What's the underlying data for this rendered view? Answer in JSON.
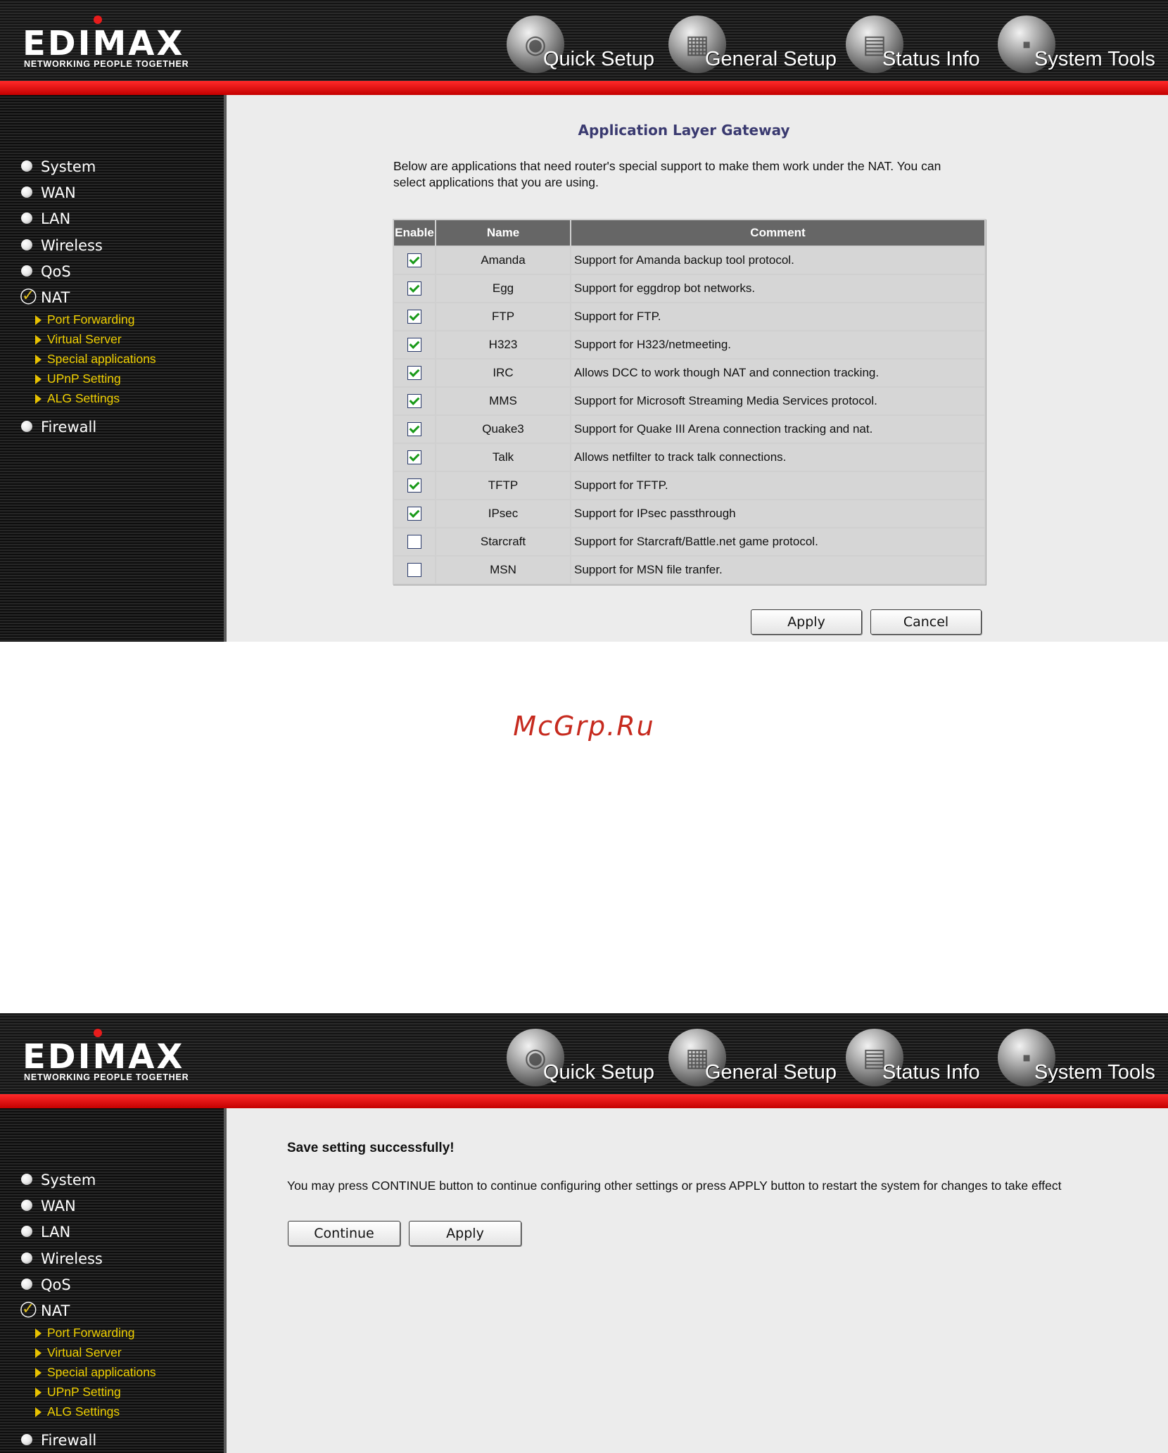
{
  "brand": {
    "logo_text": "EDIMAX",
    "tagline": "NETWORKING PEOPLE TOGETHER",
    "logo_dot_color": "#e81c1c"
  },
  "top_nav": [
    {
      "label": "Quick Setup",
      "icon": "quick-setup-orb-icon"
    },
    {
      "label": "General Setup",
      "icon": "general-setup-orb-icon"
    },
    {
      "label": "Status Info",
      "icon": "status-info-orb-icon"
    },
    {
      "label": "System Tools",
      "icon": "system-tools-orb-icon"
    }
  ],
  "sidebar": {
    "items": [
      "System",
      "WAN",
      "LAN",
      "Wireless",
      "QoS",
      "NAT",
      "Firewall"
    ],
    "active_item": "NAT",
    "subitems": [
      "Port Forwarding",
      "Virtual Server",
      "Special applications",
      "UPnP Setting",
      "ALG Settings"
    ]
  },
  "alg": {
    "title": "Application Layer Gateway",
    "description": "Below are applications that need router's special support to make them work under the NAT. You can select applications that you are using.",
    "headers": [
      "Enable",
      "Name",
      "Comment"
    ],
    "rows": [
      {
        "enabled": true,
        "name": "Amanda",
        "comment": "Support for Amanda backup tool protocol."
      },
      {
        "enabled": true,
        "name": "Egg",
        "comment": "Support for eggdrop bot networks."
      },
      {
        "enabled": true,
        "name": "FTP",
        "comment": "Support for FTP."
      },
      {
        "enabled": true,
        "name": "H323",
        "comment": "Support for H323/netmeeting."
      },
      {
        "enabled": true,
        "name": "IRC",
        "comment": "Allows DCC to work though NAT and connection tracking."
      },
      {
        "enabled": true,
        "name": "MMS",
        "comment": "Support for Microsoft Streaming Media Services protocol."
      },
      {
        "enabled": true,
        "name": "Quake3",
        "comment": "Support for Quake III Arena connection tracking and nat."
      },
      {
        "enabled": true,
        "name": "Talk",
        "comment": "Allows netfilter to track talk connections."
      },
      {
        "enabled": true,
        "name": "TFTP",
        "comment": "Support for TFTP."
      },
      {
        "enabled": true,
        "name": "IPsec",
        "comment": "Support for IPsec passthrough"
      },
      {
        "enabled": false,
        "name": "Starcraft",
        "comment": "Support for Starcraft/Battle.net game protocol."
      },
      {
        "enabled": false,
        "name": "MSN",
        "comment": "Support for MSN file tranfer."
      }
    ],
    "apply_label": "Apply",
    "cancel_label": "Cancel"
  },
  "watermark": "McGrp.Ru",
  "save": {
    "title": "Save setting successfully!",
    "description": "You may press CONTINUE button to continue configuring other settings or press APPLY button to restart the system for changes to take effect",
    "continue_label": "Continue",
    "apply_label": "Apply"
  },
  "colors": {
    "accent_red": "#e00000",
    "submenu_yellow": "#f0d000",
    "title_blue": "#3a3a70",
    "check_green": "#1a9a1a"
  }
}
